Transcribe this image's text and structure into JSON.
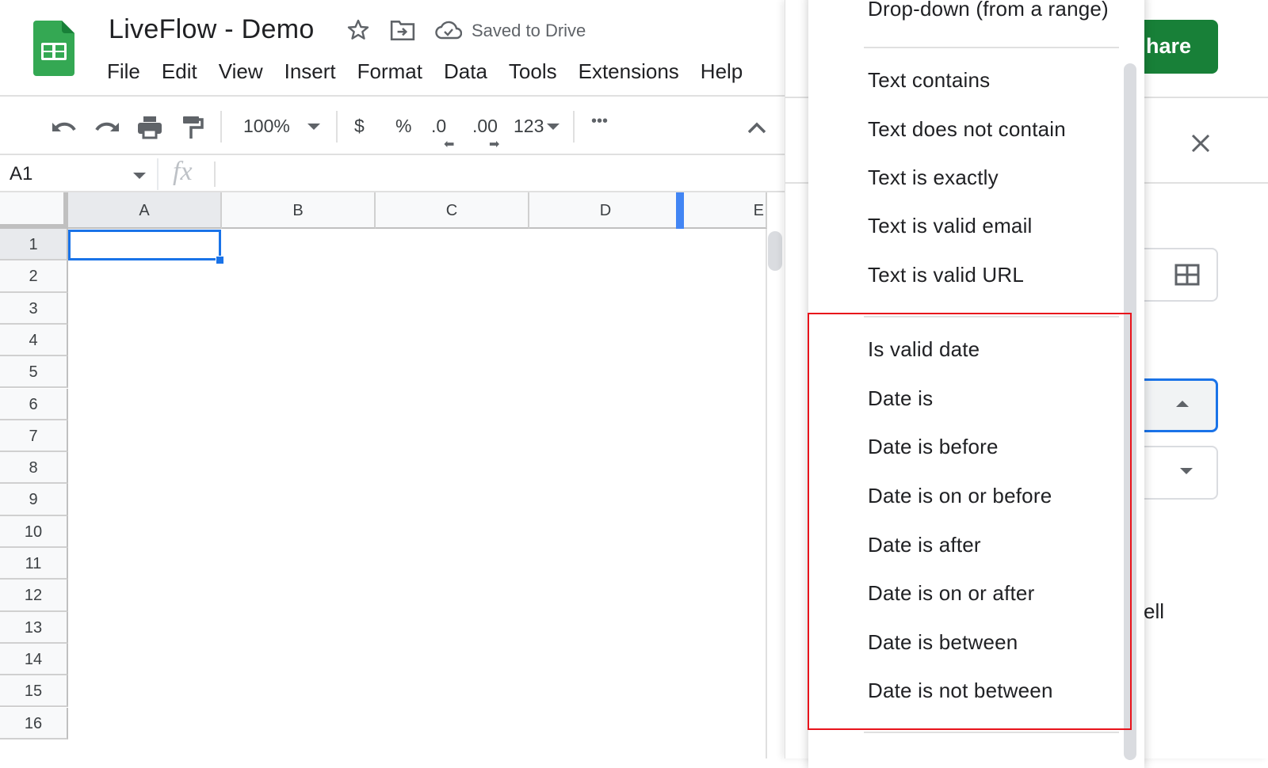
{
  "app": {
    "doc_title": "LiveFlow - Demo",
    "save_status": "Saved to Drive",
    "icons": {
      "logo": "google-sheets-logo",
      "star": "star-icon",
      "move": "move-to-folder-icon",
      "cloud": "cloud-saved-icon"
    }
  },
  "menu": [
    "File",
    "Edit",
    "View",
    "Insert",
    "Format",
    "Data",
    "Tools",
    "Extensions",
    "Help"
  ],
  "toolbar": {
    "zoom": "100%",
    "currency": "$",
    "percent": "%",
    "decrease_decimal": ".0",
    "increase_decimal": ".00",
    "more_formats": "123",
    "more": "•••"
  },
  "formula_bar": {
    "name_box": "A1",
    "fx": "fx",
    "value": ""
  },
  "grid": {
    "columns": [
      "A",
      "B",
      "C",
      "D",
      "E"
    ],
    "rows": [
      "1",
      "2",
      "3",
      "4",
      "5",
      "6",
      "7",
      "8",
      "9",
      "10",
      "11",
      "12",
      "13",
      "14",
      "15",
      "16"
    ],
    "selected_cell": "A1"
  },
  "side_panel": {
    "share_label": "hare",
    "partial_label": "cell"
  },
  "dropdown": {
    "top_item": "Drop-down (from a range)",
    "text_group": [
      "Text contains",
      "Text does not contain",
      "Text is exactly",
      "Text is valid email",
      "Text is valid URL"
    ],
    "date_group": [
      "Is valid date",
      "Date is",
      "Date is before",
      "Date is on or before",
      "Date is after",
      "Date is on or after",
      "Date is between",
      "Date is not between"
    ]
  },
  "colors": {
    "accent_blue": "#1a73e8",
    "share_green": "#188038",
    "highlight_red": "#e8131b",
    "sheets_green": "#34a853"
  }
}
